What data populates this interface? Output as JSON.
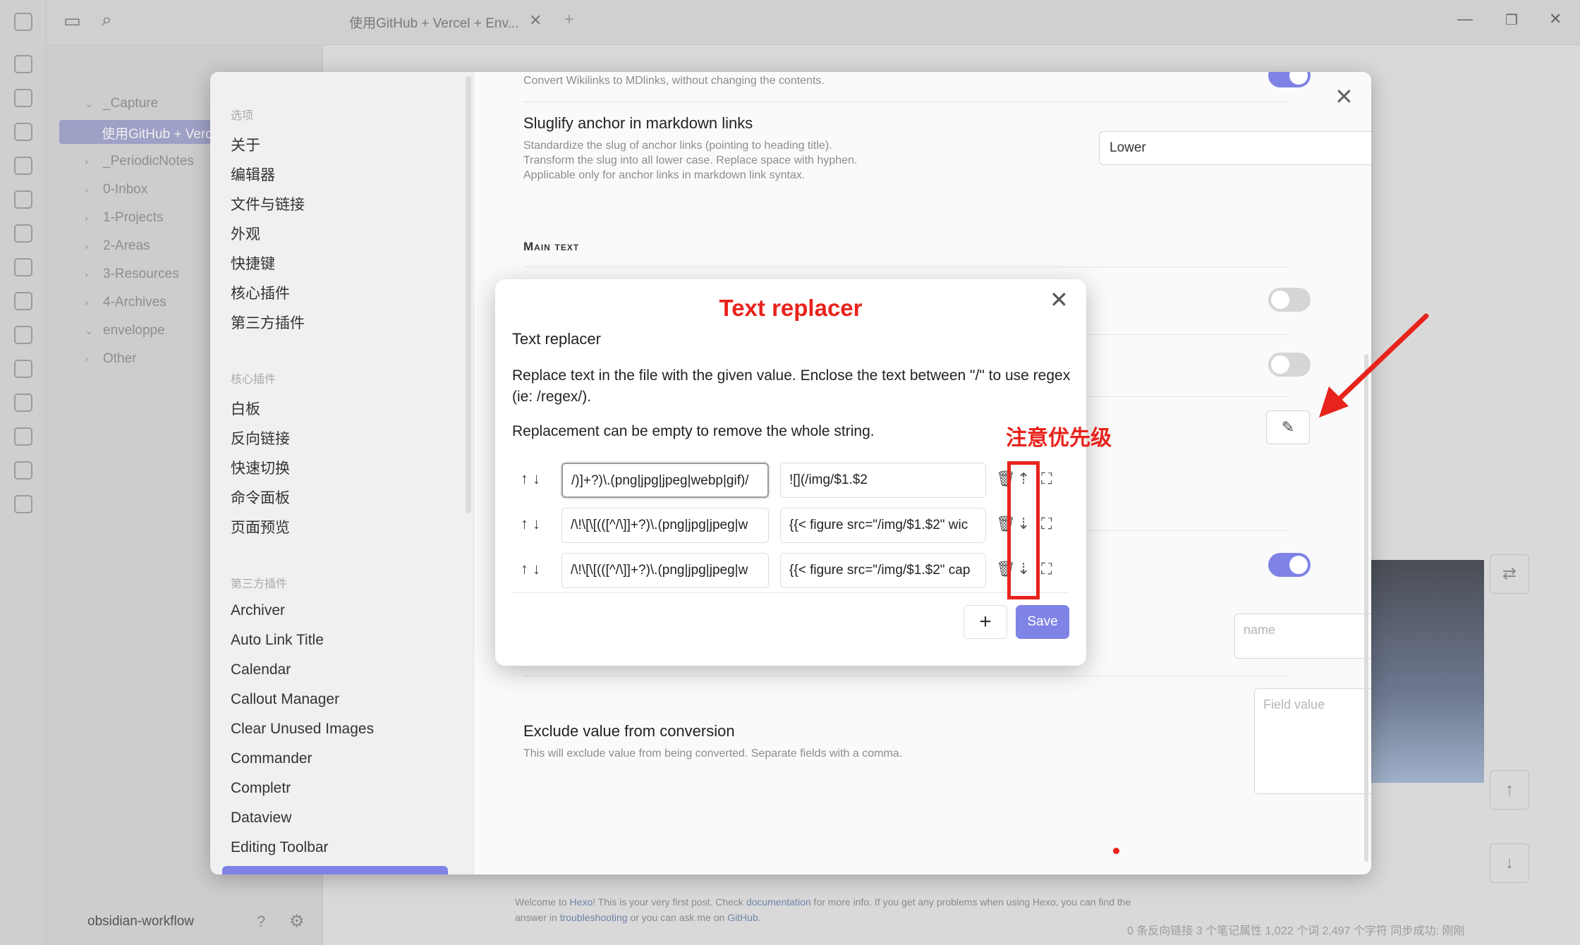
{
  "app": {
    "tab_title": "使用GitHub + Vercel + Env...",
    "vault_name": "obsidian-workflow",
    "status_bar": "0 条反向链接   3 个笔记属性   1,022 个词  2,497 个字符   同步成功: 刚刚",
    "footer": {
      "pre1": "Welcome to ",
      "l1": "Hexo",
      "pre2": "! This is your very first post. Check ",
      "l2": "documentation",
      "pre3": " for more info. If you get any problems when using Hexo, you can find the answer in ",
      "l3": "troubleshooting",
      "pre4": " or you can ask me on ",
      "l4": "GitHub",
      "post": "."
    },
    "file_tree": [
      {
        "label": "_Capture",
        "expanded": true
      },
      {
        "label": "使用GitHub + Vercel",
        "active": true
      },
      {
        "label": "_PeriodicNotes"
      },
      {
        "label": "0-Inbox"
      },
      {
        "label": "1-Projects"
      },
      {
        "label": "2-Areas"
      },
      {
        "label": "3-Resources"
      },
      {
        "label": "4-Archives"
      },
      {
        "label": "enveloppe",
        "expanded": true
      },
      {
        "label": "Other"
      }
    ]
  },
  "settings_nav": {
    "group_options": "选项",
    "options": [
      "关于",
      "编辑器",
      "文件与链接",
      "外观",
      "快捷键",
      "核心插件",
      "第三方插件"
    ],
    "group_core": "核心插件",
    "core": [
      "白板",
      "反向链接",
      "快速切换",
      "命令面板",
      "页面预览"
    ],
    "group_third": "第三方插件",
    "third": [
      "Archiver",
      "Auto Link Title",
      "Calendar",
      "Callout Manager",
      "Clear Unused Images",
      "Commander",
      "Completr",
      "Dataview",
      "Editing Toolbar"
    ]
  },
  "settings_body": {
    "top_desc": "Convert Wikilinks to MDlinks, without changing the contents.",
    "slug_title": "Sluglify anchor in markdown links",
    "slug_desc": "Standardize the slug of anchor links (pointing to heading title). Transform the slug into all lower case. Replace space with hyphen. Applicable only for anchor links in markdown link syntax.",
    "slug_value": "Lower",
    "main_text_heading": "Main text",
    "field_name_placeholder": "name",
    "field_value_placeholder": "Field value",
    "exclude_title": "Exclude value from conversion",
    "exclude_desc": "This will exclude value from being converted. Separate fields with a comma."
  },
  "text_replacer": {
    "annotation_title": "Text replacer",
    "title": "Text replacer",
    "desc": "Replace text in the file with the given value. Enclose the text between \"/\" to use regex (ie: /regex/).",
    "desc2": "Replacement can be empty to remove the whole string.",
    "rows": [
      {
        "find": "/)]+?)\\.(png|jpg|jpeg|webp|gif)/",
        "replace": "![](/img/$1.$2"
      },
      {
        "find": "/\\!\\[\\[(([^/\\]]+?)\\.(png|jpg|jpeg|w",
        "replace": "{{< figure src=\"/img/$1.$2\"  wic"
      },
      {
        "find": "/\\!\\[\\[(([^/\\]]+?)\\.(png|jpg|jpeg|w",
        "replace": "{{< figure src=\"/img/$1.$2\" cap"
      }
    ],
    "add_label": "+",
    "save_label": "Save"
  },
  "annotation": {
    "priority_note": "注意优先级",
    "color": "#e8231b"
  },
  "colors": {
    "accent": "#7f83e6",
    "annotation": "#e8231b"
  }
}
